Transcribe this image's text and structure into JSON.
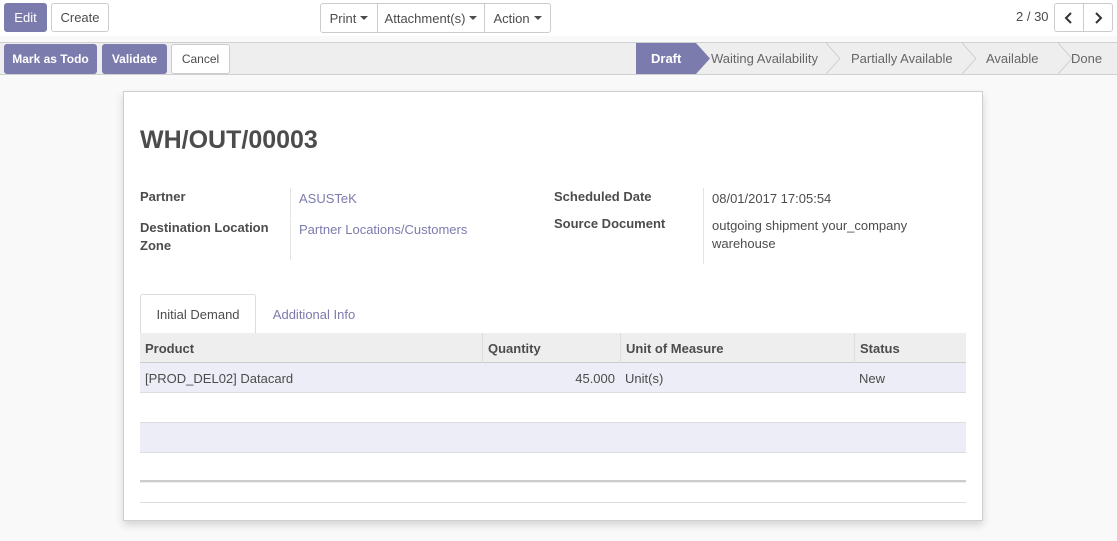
{
  "toolbar": {
    "edit_label": "Edit",
    "create_label": "Create",
    "print_label": "Print",
    "attachments_label": "Attachment(s)",
    "action_label": "Action",
    "pager_value": "2 / 30",
    "prev_icon": "chevron-left-icon",
    "next_icon": "chevron-right-icon"
  },
  "statusbar": {
    "mark_todo_label": "Mark as Todo",
    "validate_label": "Validate",
    "cancel_label": "Cancel",
    "stages": [
      "Draft",
      "Waiting Availability",
      "Partially Available",
      "Available",
      "Done"
    ],
    "active_stage": "Draft"
  },
  "record": {
    "title": "WH/OUT/00003",
    "partner_label": "Partner",
    "partner_value": "ASUSTeK",
    "dest_label": "Destination Location Zone",
    "dest_label_line1": "Destination Location",
    "dest_label_line2": "Zone",
    "dest_value": "Partner Locations/Customers",
    "scheduled_label": "Scheduled Date",
    "scheduled_value": "08/01/2017 17:05:54",
    "source_label": "Source Document",
    "source_value_line1": "outgoing shipment your_company",
    "source_value_line2": "warehouse"
  },
  "tabs": [
    {
      "label": "Initial Demand",
      "active": true
    },
    {
      "label": "Additional Info",
      "active": false
    }
  ],
  "table": {
    "columns": [
      "Product",
      "Quantity",
      "Unit of Measure",
      "Status"
    ],
    "rows": [
      {
        "product": "[PROD_DEL02] Datacard",
        "quantity": "45.000",
        "uom": "Unit(s)",
        "status": "New"
      }
    ]
  },
  "colors": {
    "accent": "#7c7bad",
    "row_highlight": "#ecedf6"
  }
}
